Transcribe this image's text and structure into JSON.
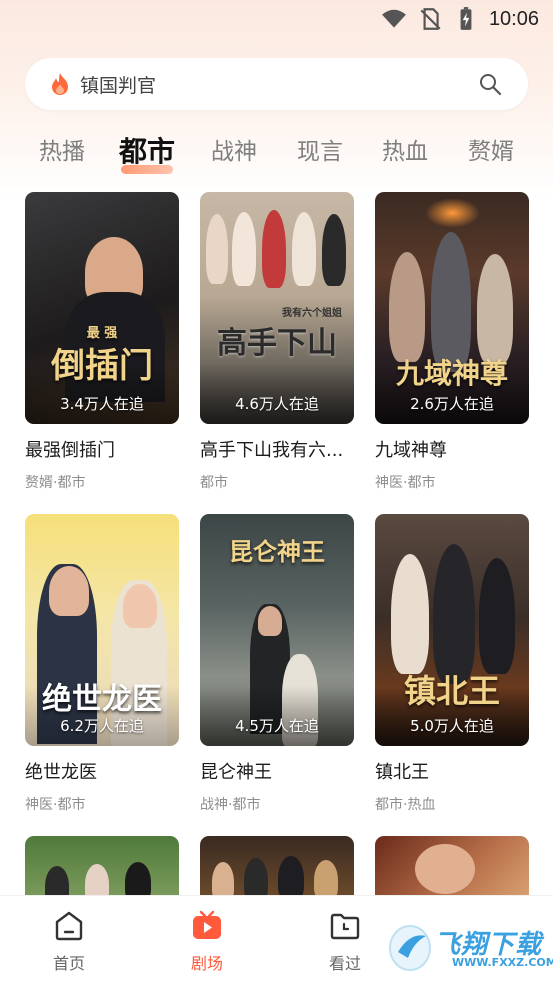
{
  "status_bar": {
    "time": "10:06"
  },
  "search": {
    "query": "镇国判官"
  },
  "tabs": [
    {
      "label": "热播",
      "active": false
    },
    {
      "label": "都市",
      "active": true
    },
    {
      "label": "战神",
      "active": false
    },
    {
      "label": "现言",
      "active": false
    },
    {
      "label": "热血",
      "active": false
    },
    {
      "label": "赘婿",
      "active": false
    }
  ],
  "dramas": [
    {
      "title": "最强倒插门",
      "tags": "赘婿·都市",
      "followers": "3.4万人在追",
      "poster_text": "倒插门",
      "poster_small": "最 强"
    },
    {
      "title": "高手下山我有六...",
      "tags": "都市",
      "followers": "4.6万人在追",
      "poster_text": "高手下山",
      "poster_small": "我有六个姐姐"
    },
    {
      "title": "九域神尊",
      "tags": "神医·都市",
      "followers": "2.6万人在追",
      "poster_text": "九域神尊"
    },
    {
      "title": "绝世龙医",
      "tags": "神医·都市",
      "followers": "6.2万人在追",
      "poster_text": "绝世龙医"
    },
    {
      "title": "昆仑神王",
      "tags": "战神·都市",
      "followers": "4.5万人在追",
      "poster_text": "昆仑神王"
    },
    {
      "title": "镇北王",
      "tags": "都市·热血",
      "followers": "5.0万人在追",
      "poster_text": "镇北王"
    }
  ],
  "bottom_nav": [
    {
      "label": "首页",
      "icon": "home-icon",
      "active": false
    },
    {
      "label": "剧场",
      "icon": "theater-play-icon",
      "active": true
    },
    {
      "label": "看过",
      "icon": "history-folder-icon",
      "active": false
    }
  ],
  "watermark": {
    "text": "飞翔下载",
    "url": "WWW.FXXZ.COM"
  },
  "colors": {
    "accent": "#ff5a3c",
    "tab_inactive": "#7f7f7f",
    "tag_gray": "#8e8e8e"
  }
}
